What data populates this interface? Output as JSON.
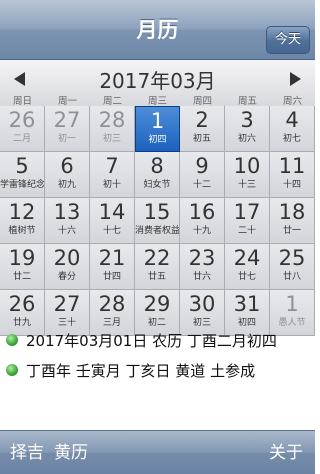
{
  "nav": {
    "title": "月历",
    "today_label": "今天"
  },
  "month": {
    "title": "2017年03月"
  },
  "weekdays": [
    "周日",
    "周一",
    "周二",
    "周三",
    "周四",
    "周五",
    "周六"
  ],
  "days": [
    {
      "num": "26",
      "sub": "二月",
      "other": true
    },
    {
      "num": "27",
      "sub": "初一",
      "other": true
    },
    {
      "num": "28",
      "sub": "初三",
      "other": true
    },
    {
      "num": "1",
      "sub": "初四",
      "selected": true
    },
    {
      "num": "2",
      "sub": "初五"
    },
    {
      "num": "3",
      "sub": "初六"
    },
    {
      "num": "4",
      "sub": "初七"
    },
    {
      "num": "5",
      "sub": "学雷锋纪念"
    },
    {
      "num": "6",
      "sub": "初九"
    },
    {
      "num": "7",
      "sub": "初十"
    },
    {
      "num": "8",
      "sub": "妇女节"
    },
    {
      "num": "9",
      "sub": "十二"
    },
    {
      "num": "10",
      "sub": "十三"
    },
    {
      "num": "11",
      "sub": "十四"
    },
    {
      "num": "12",
      "sub": "植树节"
    },
    {
      "num": "13",
      "sub": "十六"
    },
    {
      "num": "14",
      "sub": "十七"
    },
    {
      "num": "15",
      "sub": "消费者权益"
    },
    {
      "num": "16",
      "sub": "十九"
    },
    {
      "num": "17",
      "sub": "二十"
    },
    {
      "num": "18",
      "sub": "廿一"
    },
    {
      "num": "19",
      "sub": "廿二"
    },
    {
      "num": "20",
      "sub": "春分"
    },
    {
      "num": "21",
      "sub": "廿四"
    },
    {
      "num": "22",
      "sub": "廿五"
    },
    {
      "num": "23",
      "sub": "廿六"
    },
    {
      "num": "24",
      "sub": "廿七"
    },
    {
      "num": "25",
      "sub": "廿八"
    },
    {
      "num": "26",
      "sub": "廿九"
    },
    {
      "num": "27",
      "sub": "三十"
    },
    {
      "num": "28",
      "sub": "三月"
    },
    {
      "num": "29",
      "sub": "初二"
    },
    {
      "num": "30",
      "sub": "初三"
    },
    {
      "num": "31",
      "sub": "初四"
    },
    {
      "num": "1",
      "sub": "愚人节",
      "other": true
    }
  ],
  "info": {
    "line1": "2017年03月01日  农历 丁酉二月初四",
    "line2": "丁酉年 壬寅月 丁亥日 黄道 土参成"
  },
  "footer": {
    "item1": "择吉",
    "item2": "黄历",
    "about": "关于"
  }
}
